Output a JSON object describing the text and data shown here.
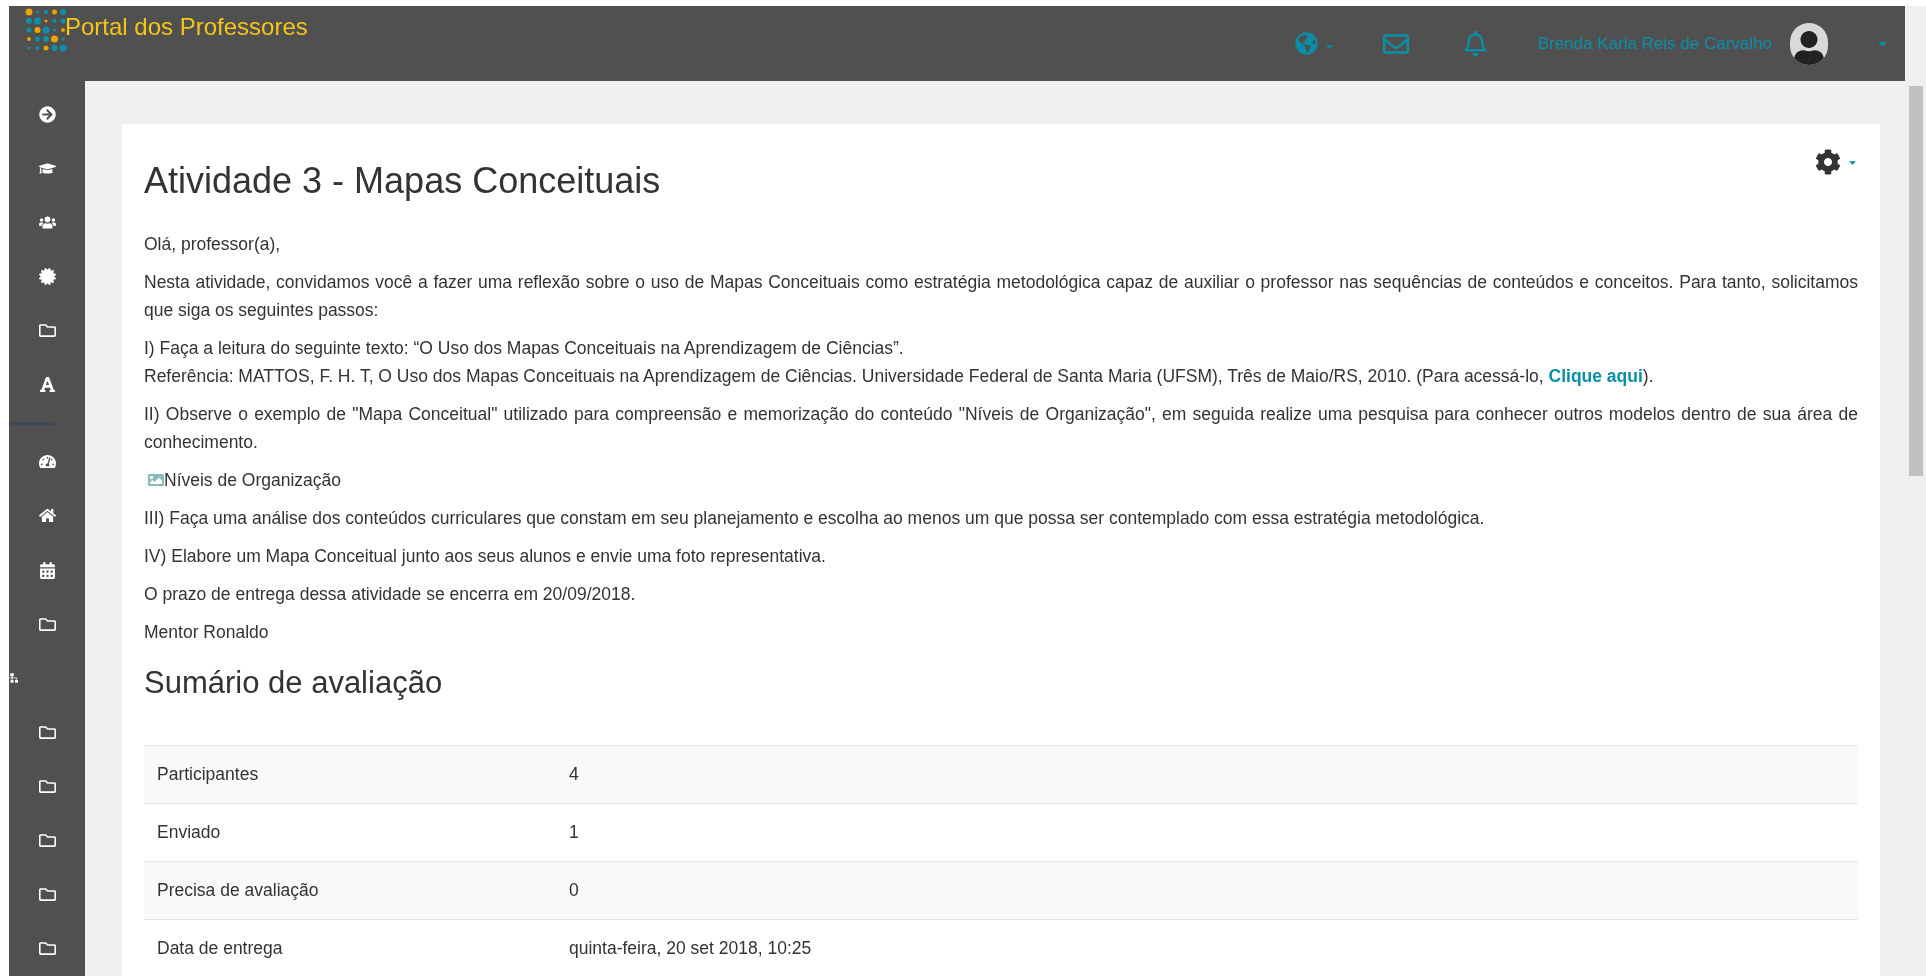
{
  "header": {
    "brand": "Portal dos Professores",
    "user_name": "Brenda Karla Reis de Carvalho"
  },
  "page": {
    "title": "Atividade 3 - Mapas Conceituais",
    "paragraphs": [
      {
        "kind": "text",
        "text": "Olá, professor(a),"
      },
      {
        "kind": "text",
        "text": "Nesta atividade, convidamos você a fazer uma reflexão sobre o uso de Mapas Conceituais como estratégia metodológica capaz de auxiliar o professor nas sequências de conteúdos e conceitos. Para tanto, solicitamos que siga os seguintes passos:"
      },
      {
        "kind": "reference",
        "text": "I) Faça a leitura do seguinte texto:  “O Uso dos Mapas Conceituais na Aprendizagem de Ciências”.",
        "ref_before": "Referência: MATTOS, F. H. T, O Uso dos Mapas Conceituais na Aprendizagem de Ciências. Universidade Federal de Santa Maria (UFSM), Três de Maio/RS, 2010. (Para acessá-lo, ",
        "link": "Clique aqui",
        "ref_after": ")."
      },
      {
        "kind": "text",
        "text": "II) Observe o exemplo de \"Mapa Conceitual\" utilizado para compreensão e memorização do conteúdo \"Níveis de Organização\", em seguida realize uma pesquisa para conhecer outros modelos dentro de sua área de conhecimento."
      },
      {
        "kind": "image",
        "text": "Níveis de Organização"
      },
      {
        "kind": "text",
        "text": "III) Faça uma análise dos conteúdos curriculares que constam em seu planejamento e escolha ao menos um que possa ser contemplado com essa estratégia metodológica."
      },
      {
        "kind": "text",
        "text": "IV) Elabore um Mapa Conceitual junto aos seus alunos e envie uma foto representativa."
      },
      {
        "kind": "text",
        "text": "O prazo de entrega dessa atividade se encerra em 20/09/2018."
      },
      {
        "kind": "text",
        "text": "Mentor Ronaldo"
      }
    ],
    "summary_title": "Sumário de avaliação",
    "summary_rows": [
      {
        "label": "Participantes",
        "value": "4"
      },
      {
        "label": "Enviado",
        "value": "1"
      },
      {
        "label": "Precisa de avaliação",
        "value": "0"
      },
      {
        "label": "Data de entrega",
        "value": "quinta-feira, 20 set 2018, 10:25"
      }
    ]
  }
}
